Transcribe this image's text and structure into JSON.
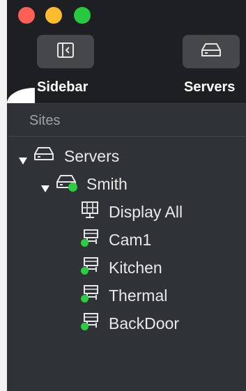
{
  "toolbar": {
    "sidebar_label": "Sidebar",
    "servers_label": "Servers"
  },
  "sidebar": {
    "header": "Sites",
    "tree": {
      "root_label": "Servers",
      "server_label": "Smith",
      "items": [
        {
          "label": "Display All",
          "icon": "display-grid-icon"
        },
        {
          "label": "Cam1",
          "icon": "camera-node-icon",
          "status": "online"
        },
        {
          "label": "Kitchen",
          "icon": "camera-node-icon",
          "status": "online"
        },
        {
          "label": "Thermal",
          "icon": "camera-node-icon",
          "status": "online"
        },
        {
          "label": "BackDoor",
          "icon": "camera-node-icon",
          "status": "online"
        }
      ]
    }
  },
  "colors": {
    "online": "#2ecc40",
    "background": "#2f3237",
    "titlebar": "#1e1f22"
  }
}
